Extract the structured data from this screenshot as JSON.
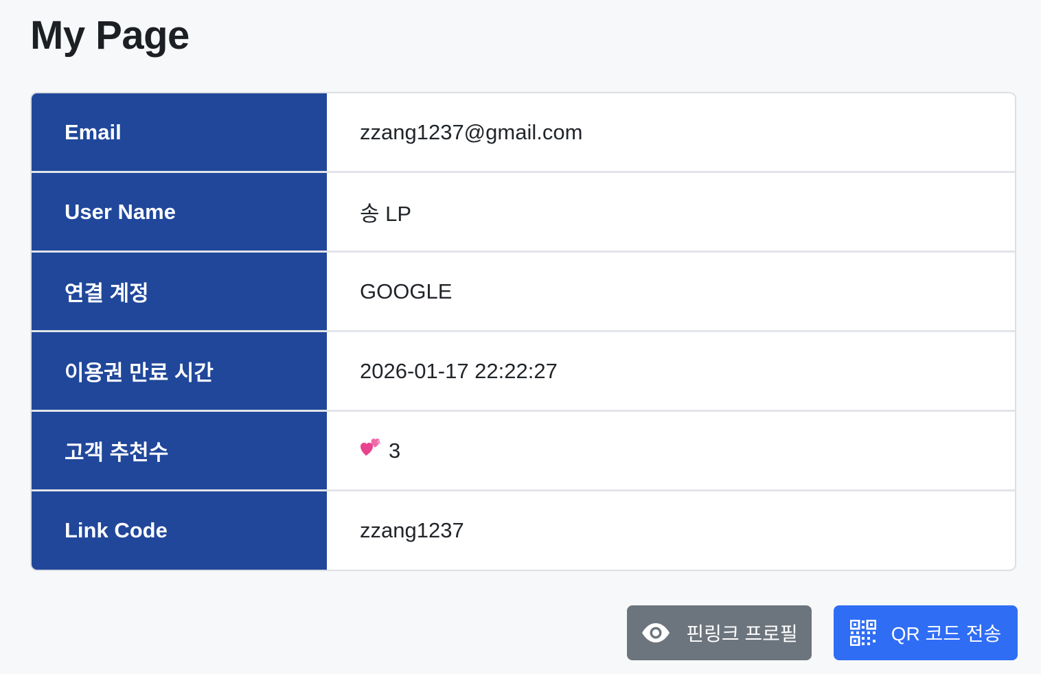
{
  "page": {
    "title": "My Page"
  },
  "profile": {
    "rows": [
      {
        "label": "Email",
        "value": "zzang1237@gmail.com"
      },
      {
        "label": "User Name",
        "value": "송 LP"
      },
      {
        "label": "연결 계정",
        "value": "GOOGLE"
      },
      {
        "label": "이용권 만료 시간",
        "value": "2026-01-17 22:22:27"
      },
      {
        "label": "고객 추천수",
        "value": "3"
      },
      {
        "label": "Link Code",
        "value": "zzang1237"
      }
    ]
  },
  "actions": {
    "profile_label": "핀링크 프로필",
    "qr_label": "QR 코드 전송"
  },
  "icons": {
    "recommend": "two-hearts-icon",
    "profile": "eye-icon",
    "qr": "qr-code-icon"
  },
  "colors": {
    "label_background": "#20479a",
    "profile_button": "#6c757d",
    "qr_button": "#2f6df5"
  }
}
